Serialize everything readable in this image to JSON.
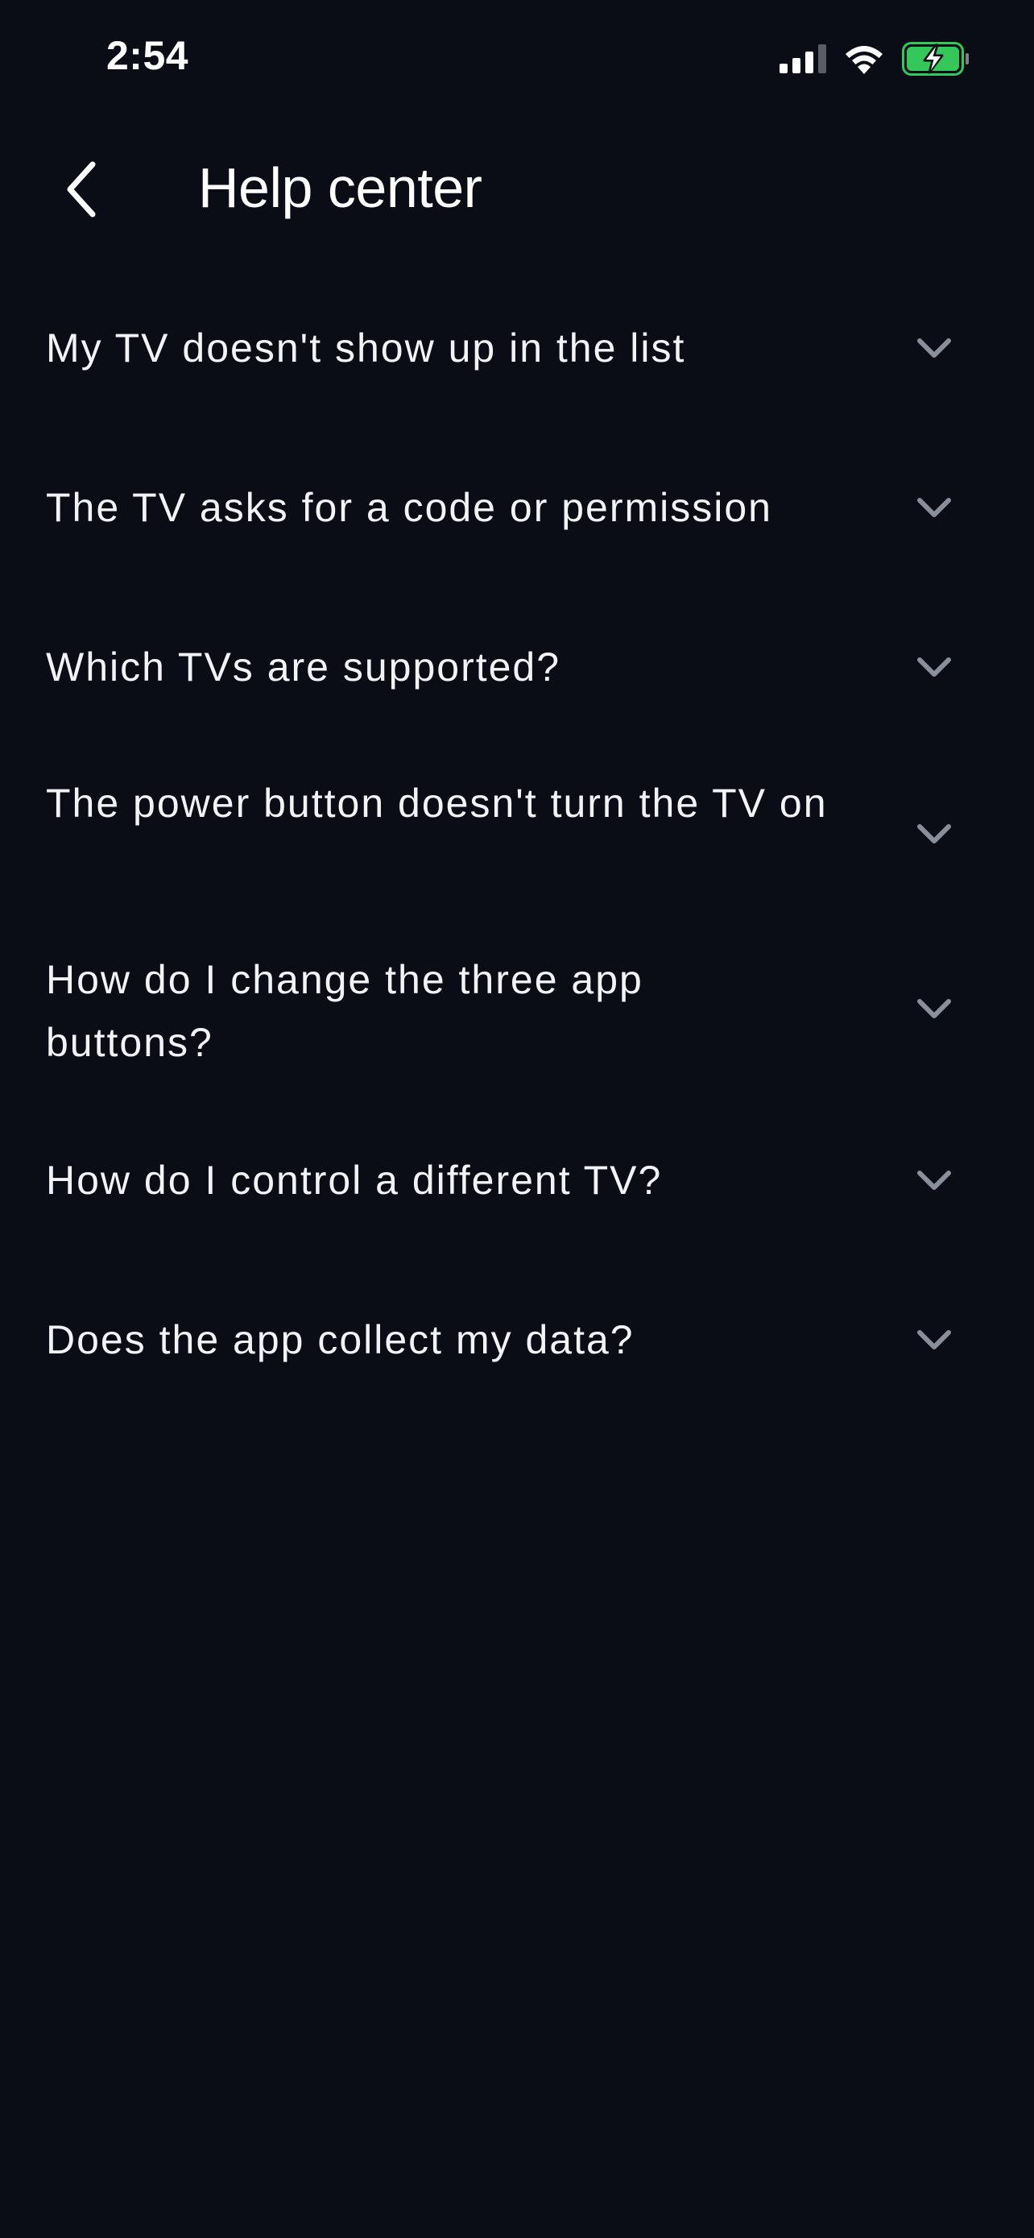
{
  "status_bar": {
    "time": "2:54",
    "icons": [
      "cellular-signal-icon",
      "wifi-icon",
      "battery-charging-icon"
    ],
    "battery_color": "#34c759"
  },
  "header": {
    "back_icon": "chevron-left-icon",
    "title": "Help center"
  },
  "faq": {
    "items": [
      {
        "question": "My TV doesn't show up in the list",
        "icon": "chevron-down-icon"
      },
      {
        "question": "The TV asks for a code or permission",
        "icon": "chevron-down-icon"
      },
      {
        "question": "Which TVs are supported?",
        "icon": "chevron-down-icon"
      },
      {
        "question": "The power button doesn't turn the TV on",
        "icon": "chevron-down-icon"
      },
      {
        "question": "How do I change the three app buttons?",
        "icon": "chevron-down-icon"
      },
      {
        "question": "How do I control a different TV?",
        "icon": "chevron-down-icon"
      },
      {
        "question": "Does the app collect my data?",
        "icon": "chevron-down-icon"
      }
    ]
  },
  "colors": {
    "background": "#0a0d16",
    "text": "#f2f3f6",
    "chevron": "#8a8f9c"
  }
}
